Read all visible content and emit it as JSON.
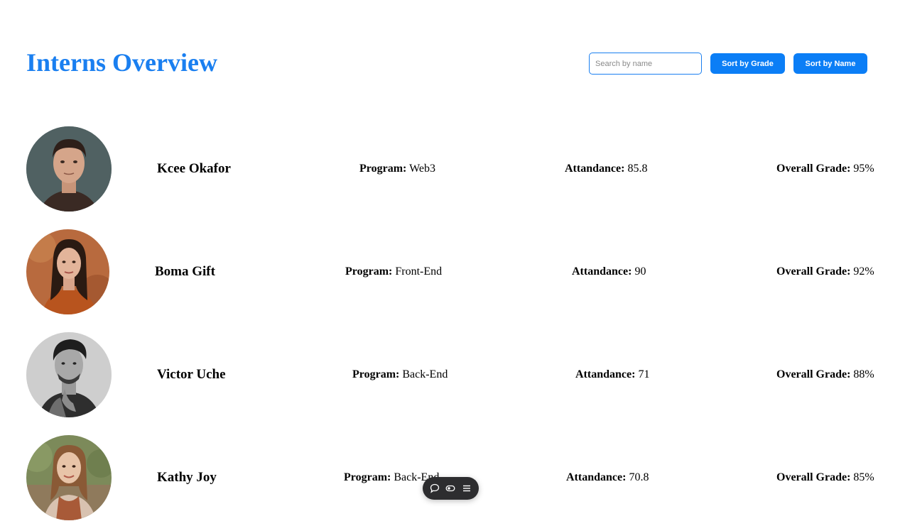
{
  "header": {
    "title": "Interns Overview",
    "search_placeholder": "Search by name",
    "search_value": "",
    "sort_grade_label": "Sort by Grade",
    "sort_name_label": "Sort by Name"
  },
  "labels": {
    "program": "Program:",
    "attendance": "Attandance:",
    "grade": "Overall Grade:"
  },
  "interns": [
    {
      "name": "Kcee Okafor",
      "program": "Web3",
      "attendance": "85.8",
      "grade": "95%",
      "avatar": "man-portrait"
    },
    {
      "name": "Boma Gift",
      "program": "Front-End",
      "attendance": "90",
      "grade": "92%",
      "avatar": "woman-portrait"
    },
    {
      "name": "Victor Uche",
      "program": "Back-End",
      "attendance": "71",
      "grade": "88%",
      "avatar": "man-portrait-bw"
    },
    {
      "name": "Kathy Joy",
      "program": "Back-End",
      "attendance": "70.8",
      "grade": "85%",
      "avatar": "woman-portrait"
    }
  ],
  "floating_toolbar": {
    "icons": [
      "comment-icon",
      "toggle-icon",
      "menu-icon"
    ]
  }
}
